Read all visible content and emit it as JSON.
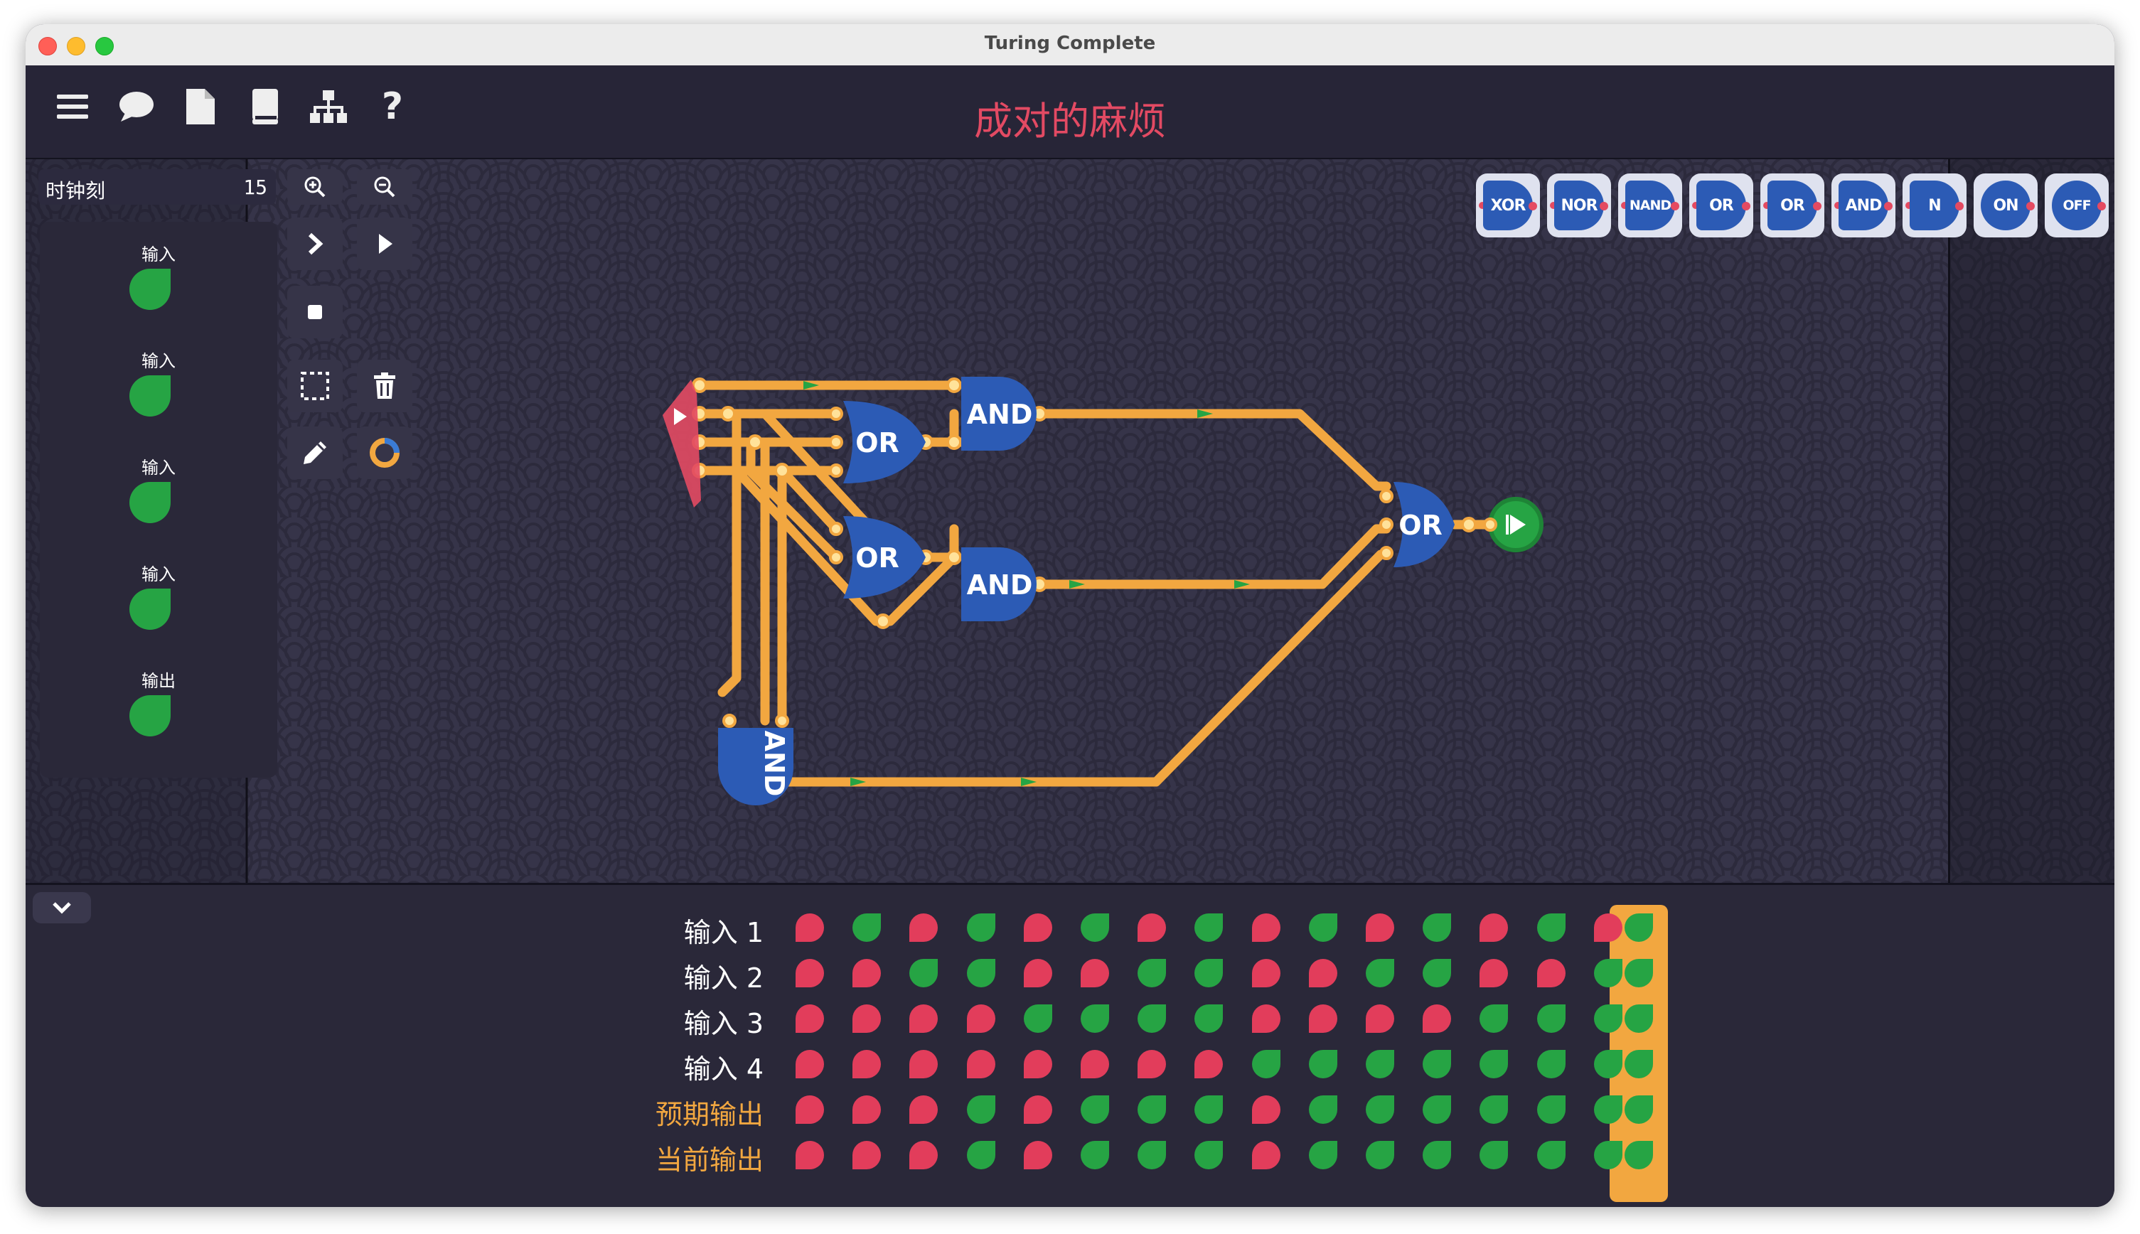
{
  "window": {
    "title": "Turing Complete"
  },
  "toolbar": {
    "icons": [
      "menu-icon",
      "chat-icon",
      "document-icon",
      "book-icon",
      "hierarchy-icon",
      "help-icon"
    ],
    "help_label": "?"
  },
  "level": {
    "title": "成对的麻烦"
  },
  "tick": {
    "label": "时钟刻",
    "value": "15"
  },
  "io_panel": {
    "items": [
      {
        "label": "输入"
      },
      {
        "label": "输入"
      },
      {
        "label": "输入"
      },
      {
        "label": "输入"
      },
      {
        "label": "输出"
      }
    ]
  },
  "controls": [
    "zoom-in-icon",
    "zoom-out-icon",
    "step-icon",
    "play-icon",
    "stop-icon",
    "select-icon",
    "delete-icon",
    "pencil-icon",
    "color-ring-icon"
  ],
  "gate_palette": [
    {
      "label": "XOR"
    },
    {
      "label": "NOR"
    },
    {
      "label": "NAND"
    },
    {
      "label": "OR"
    },
    {
      "label": "OR"
    },
    {
      "label": "AND"
    },
    {
      "label": "N"
    },
    {
      "label": "ON"
    },
    {
      "label": "OFF"
    }
  ],
  "circuit": {
    "gates": [
      {
        "label": "AND"
      },
      {
        "label": "OR"
      },
      {
        "label": "OR"
      },
      {
        "label": "AND"
      },
      {
        "label": "OR"
      },
      {
        "label": "AND"
      }
    ]
  },
  "truth_table": {
    "rows": [
      {
        "label": "输入 1",
        "color": "#ffffff",
        "values": [
          0,
          1,
          0,
          1,
          0,
          1,
          0,
          1,
          0,
          1,
          0,
          1,
          0,
          1,
          0,
          1
        ]
      },
      {
        "label": "输入 2",
        "color": "#ffffff",
        "values": [
          0,
          0,
          1,
          1,
          0,
          0,
          1,
          1,
          0,
          0,
          1,
          1,
          0,
          0,
          1,
          1
        ]
      },
      {
        "label": "输入 3",
        "color": "#ffffff",
        "values": [
          0,
          0,
          0,
          0,
          1,
          1,
          1,
          1,
          0,
          0,
          0,
          0,
          1,
          1,
          1,
          1
        ]
      },
      {
        "label": "输入 4",
        "color": "#ffffff",
        "values": [
          0,
          0,
          0,
          0,
          0,
          0,
          0,
          0,
          1,
          1,
          1,
          1,
          1,
          1,
          1,
          1
        ]
      },
      {
        "label": "预期输出",
        "color": "#f2a740",
        "values": [
          0,
          0,
          0,
          1,
          0,
          1,
          1,
          1,
          0,
          1,
          1,
          1,
          1,
          1,
          1,
          1
        ]
      },
      {
        "label": "当前输出",
        "color": "#f2a740",
        "values": [
          0,
          0,
          0,
          1,
          0,
          1,
          1,
          1,
          0,
          1,
          1,
          1,
          1,
          1,
          1,
          1
        ]
      }
    ],
    "current_index": 15
  },
  "colors": {
    "background": "#272537",
    "wire": "#f2a740",
    "gate": "#2c5bb5",
    "on": "#26a444",
    "off": "#e23d5b",
    "title_red": "#e34a63"
  }
}
